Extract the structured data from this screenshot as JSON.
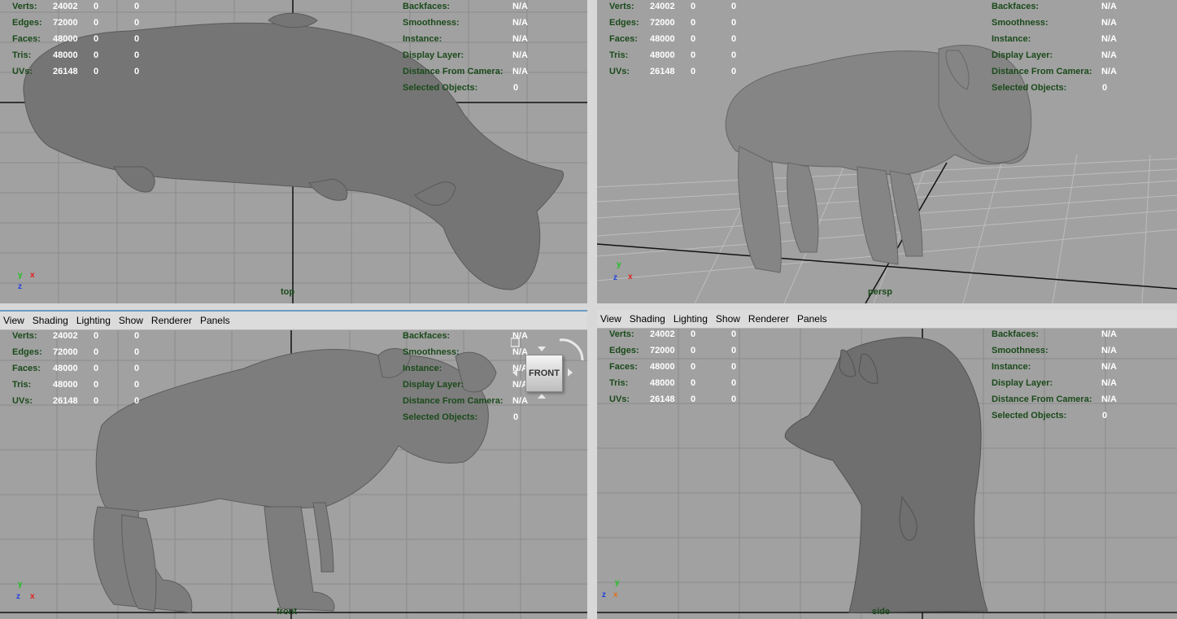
{
  "menu": [
    "View",
    "Shading",
    "Lighting",
    "Show",
    "Renderer",
    "Panels"
  ],
  "hud_left": [
    {
      "label": "Verts:",
      "v1": "24002",
      "v2": "0",
      "v3": "0"
    },
    {
      "label": "Edges:",
      "v1": "72000",
      "v2": "0",
      "v3": "0"
    },
    {
      "label": "Faces:",
      "v1": "48000",
      "v2": "0",
      "v3": "0"
    },
    {
      "label": "Tris:",
      "v1": "48000",
      "v2": "0",
      "v3": "0"
    },
    {
      "label": "UVs:",
      "v1": "26148",
      "v2": "0",
      "v3": "0"
    }
  ],
  "hud_right": [
    {
      "label": "Backfaces:",
      "value": "N/A"
    },
    {
      "label": "Smoothness:",
      "value": "N/A"
    },
    {
      "label": "Instance:",
      "value": "N/A"
    },
    {
      "label": "Display Layer:",
      "value": "N/A"
    },
    {
      "label": "Distance From Camera:",
      "value": "N/A"
    },
    {
      "label": "Selected Objects:",
      "value": "0"
    }
  ],
  "viewports": {
    "top": {
      "camera": "top"
    },
    "persp": {
      "camera": "persp"
    },
    "front": {
      "camera": "front",
      "viewcube": "FRONT"
    },
    "side": {
      "camera": "side"
    }
  },
  "axes": {
    "x": "x",
    "y": "y",
    "z": "z"
  },
  "colors": {
    "viewport_bg": "#a1a1a1",
    "hud_label": "#1a4a1a",
    "model": "#7a7a7a",
    "x_axis": "#e02020",
    "y_axis": "#20c020",
    "z_axis": "#2040e0"
  }
}
